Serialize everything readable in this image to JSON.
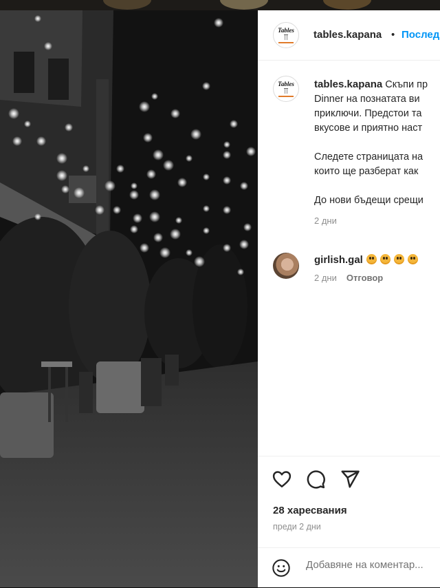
{
  "header": {
    "username": "tables.kapana",
    "separator": "•",
    "follow_label": "Последвай"
  },
  "caption": {
    "username": "tables.kapana",
    "lines": [
      "Скъпи пр",
      "Dinner на познатата ви",
      "приключи. Предстои та",
      "вкусове и приятно наст",
      "",
      "Следете страницата на",
      "които ще разберат как",
      "",
      "До нови бъдещи срещи"
    ],
    "time": "2 дни"
  },
  "comment": {
    "username": "girlish.gal",
    "emoji": [
      "flushed-face",
      "flushed-face",
      "flushed-face",
      "flushed-face"
    ],
    "time": "2 дни",
    "reply_label": "Отговор"
  },
  "actions": {
    "likes": "28 харесвания",
    "posted_ago": "преди 2 дни"
  },
  "comment_box": {
    "placeholder": "Добавяне на коментар..."
  },
  "logo": {
    "word": "Tables"
  },
  "colors": {
    "link": "#0095f6",
    "muted": "#8e8e8e",
    "text": "#262626"
  }
}
